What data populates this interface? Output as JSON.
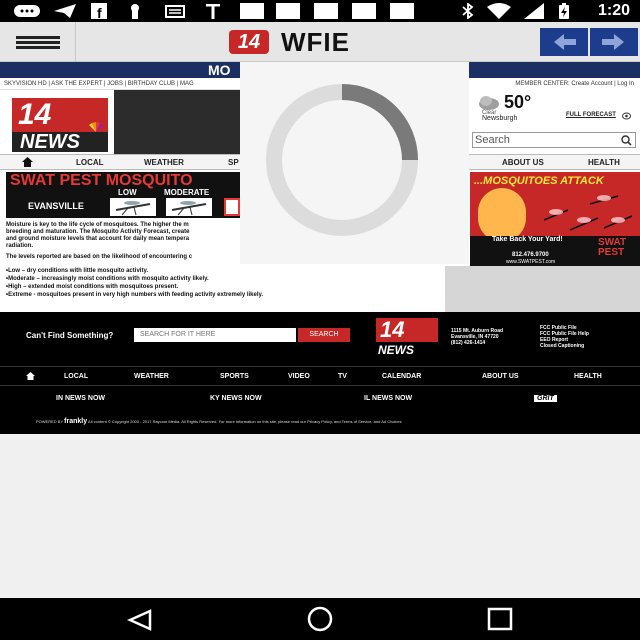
{
  "status_bar": {
    "time": "1:20",
    "icons": [
      "chat-icon",
      "send-icon",
      "facebook-icon",
      "keyhole-icon",
      "stack-icon",
      "t-icon",
      "bluetooth-icon",
      "wifi-icon",
      "signal-icon",
      "battery-icon"
    ]
  },
  "app_bar": {
    "logo_number": "14",
    "logo_text": "WFIE",
    "back_icon": "arrow-left-icon",
    "forward_icon": "arrow-right-icon"
  },
  "page": {
    "blue_bar_text": "MO",
    "top_nav_left": "SKYVISION HD  |  ASK THE EXPERT  |  JOBS  |  BIRTHDAY CLUB  |  MAG",
    "top_nav_right": "MEMBER CENTER:  Create Account  |  Log In",
    "news_logo_number": "14",
    "news_logo_word": "NEWS",
    "weather": {
      "temp": "50°",
      "condition": "Clear",
      "city": "Newsburgh",
      "forecast_link": "FULL FORECAST"
    },
    "search_placeholder": "Search",
    "main_nav": [
      "LOCAL",
      "WEATHER",
      "SP",
      "ABOUT US",
      "HEALTH"
    ],
    "banner": {
      "title": "SWAT PEST MOSQUITO",
      "low": "LOW",
      "moderate": "MODERATE",
      "city": "EVANSVILLE"
    },
    "ad": {
      "headline": "...MOSQUITOES ATTACK",
      "tagline": "Take Back Your Yard!",
      "phone": "812.476.9700",
      "web": "www.SWATPEST.com",
      "brand_1": "SWAT",
      "brand_2": "PEST"
    },
    "paragraphs": [
      "Moisture is key to the life cycle of mosquitoes. The higher the m",
      "breeding and maturation. The Mosquito Activity Forecast, create",
      "and ground moisture levels that account for daily mean tempera",
      "radiation.",
      "The levels reported are based on the likelihood of encountering c",
      "•Low – dry conditions with little mosquito activity.",
      "•Moderate – increasingly moist conditions with mosquito activity likely.",
      "•High – extended moist conditions with mosquitoes present.",
      "•Extreme - mosquitoes present in very high numbers with feeding activity extremely likely."
    ]
  },
  "footer": {
    "cant_find": "Can't Find Something?",
    "search_placeholder": "SEARCH FOR IT HERE",
    "search_button": "SEARCH",
    "logo_number": "14",
    "logo_word": "NEWS",
    "address": [
      "1115 Mt. Auburn Road",
      "Evansville, IN 47720",
      "(812) 426-1414"
    ],
    "links": [
      "FCC Public File",
      "FCC Public File Help",
      "EEO Report",
      "Closed Captioning"
    ],
    "nav": [
      "LOCAL",
      "WEATHER",
      "SPORTS",
      "VIDEO",
      "TV",
      "CALENDAR",
      "ABOUT US",
      "HEALTH"
    ],
    "nav2": [
      "IN NEWS NOW",
      "KY NEWS NOW",
      "IL NEWS NOW",
      "GRIT"
    ],
    "powered_by": "POWERED BY",
    "frankly": "frankly",
    "copyright": "All content © Copyright 2000 - 2017 Raycom Media. All Rights Reserved. For more information on this site, please read our Privacy Policy, and Terms of Service, and Ad Choices"
  },
  "navigation_bar": {
    "back": "back-triangle-icon",
    "home": "home-circle-icon",
    "recents": "recents-square-icon"
  },
  "colors": {
    "brand_red": "#c62828",
    "nav_blue": "#1e3c8c",
    "header_blue": "#1c2f63"
  },
  "loading_progress": 0.25
}
